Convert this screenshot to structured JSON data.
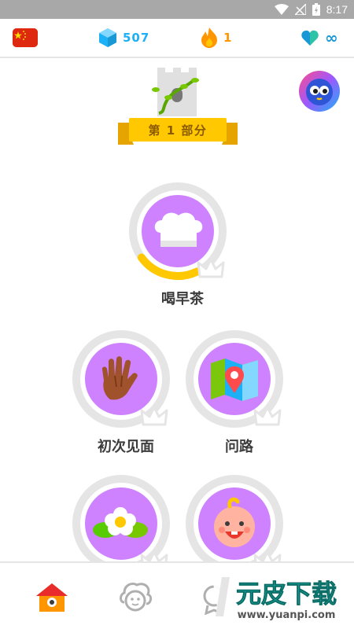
{
  "status_bar": {
    "time": "8:17"
  },
  "stats": {
    "language_flag": "china-flag-icon",
    "gems": "507",
    "streak": "1",
    "hearts": "∞"
  },
  "section": {
    "banner_label": "第 1 部分"
  },
  "units": [
    {
      "label": "喝早茶",
      "icon": "chef-hat-icon",
      "progress": 0.22
    },
    {
      "label": "初次见面",
      "icon": "hand-wave-icon",
      "progress": 0
    },
    {
      "label": "问路",
      "icon": "map-pin-icon",
      "progress": 0
    },
    {
      "label": "",
      "icon": "flower-icon",
      "progress": 0
    },
    {
      "label": "",
      "icon": "baby-face-icon",
      "progress": 0
    }
  ],
  "bottom_nav": {
    "items": [
      "home-icon",
      "characters-icon",
      "leaderboard-icon"
    ]
  },
  "watermark": {
    "title": "元皮下载",
    "url": "www.yuanpi.com"
  },
  "colors": {
    "gem": "#1cb0f6",
    "streak": "#ff9600",
    "heart": "#1899d6",
    "unit_purple": "#ce82ff",
    "gold": "#ffc800",
    "ring": "#e5e5e5"
  }
}
